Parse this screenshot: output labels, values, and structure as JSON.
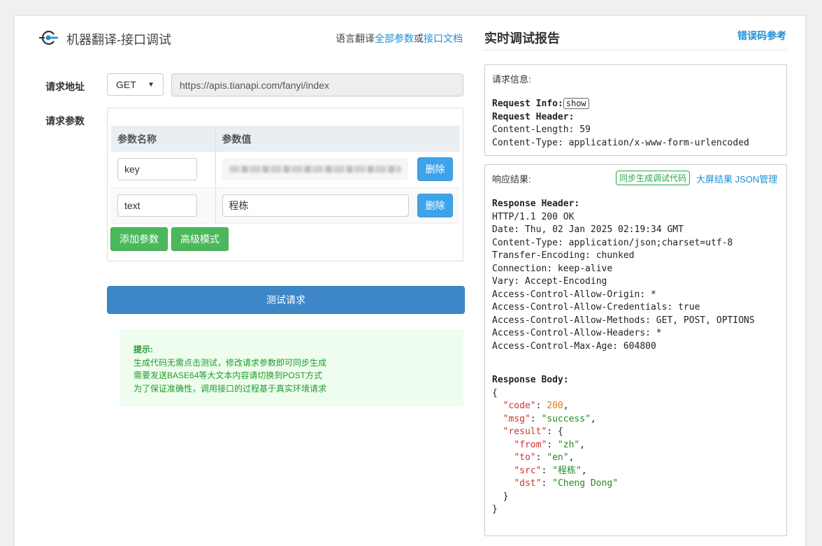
{
  "header": {
    "title": "机器翻译-接口调试",
    "links_prefix": "语言翻译",
    "link_all_params": "全部参数",
    "links_or": "或",
    "link_api_doc": "接口文档"
  },
  "request": {
    "address_label": "请求地址",
    "method": "GET",
    "url": "https://apis.tianapi.com/fanyi/index",
    "params_label": "请求参数",
    "col_name": "参数名称",
    "col_value": "参数值",
    "rows": [
      {
        "name": "key",
        "value": "",
        "delete_label": "删除"
      },
      {
        "name": "text",
        "value": "程栋",
        "delete_label": "删除"
      }
    ],
    "add_param_label": "添加参数",
    "advanced_label": "高级模式",
    "test_label": "测试请求"
  },
  "tips": {
    "title": "提示:",
    "lines": [
      "生成代码无需点击测试，修改请求参数即可同步生成",
      "需要发送BASE64等大文本内容请切换到POST方式",
      "为了保证准确性，调用接口的过程基于真实环境请求"
    ]
  },
  "report": {
    "title": "实时调试报告",
    "error_link": "错误码参考",
    "request_info_label": "请求信息:",
    "request_info_key": "Request Info:",
    "show_label": "show",
    "request_header_key": "Request Header:",
    "request_headers": [
      "Content-Length: 59",
      "Content-Type: application/x-www-form-urlencoded"
    ],
    "response_label": "响应结果:",
    "sync_code_label": "同步生成调试代码",
    "big_screen_label": "大屏结果 JSON管理",
    "response_header_key": "Response Header:",
    "response_headers": [
      "HTTP/1.1 200 OK",
      "Date: Thu, 02 Jan 2025 02:19:34 GMT",
      "Content-Type: application/json;charset=utf-8",
      "Transfer-Encoding: chunked",
      "Connection: keep-alive",
      "Vary: Accept-Encoding",
      "Access-Control-Allow-Origin: *",
      "Access-Control-Allow-Credentials: true",
      "Access-Control-Allow-Methods: GET, POST, OPTIONS",
      "Access-Control-Allow-Headers: *",
      "Access-Control-Max-Age: 604800"
    ],
    "response_body_key": "Response Body:",
    "body": {
      "code": 200,
      "msg": "success",
      "result": {
        "from": "zh",
        "to": "en",
        "src": "程栋",
        "dst": "Cheng Dong"
      }
    }
  },
  "colors": {
    "link": "#1a8fd6",
    "primary_button": "#3d87c8",
    "delete_button": "#3fa3e9",
    "green_button": "#4cb85c",
    "tips_bg": "#effdee",
    "tips_text": "#1f9b2c"
  },
  "icons": {
    "logo": "key-circle-icon"
  }
}
